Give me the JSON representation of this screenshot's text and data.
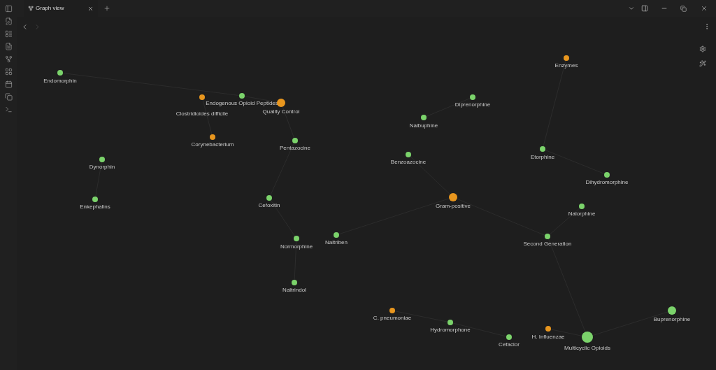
{
  "tabs": [
    {
      "label": "Graph view",
      "selected": true
    }
  ],
  "graph": {
    "nodes": [
      {
        "label": "Endomorphin",
        "color": "#7bd36b"
      },
      {
        "label": "Clostridioides difficile",
        "color": "#e8961e"
      },
      {
        "label": "Endogenous Opioid Peptides",
        "color": "#7bd36b"
      },
      {
        "label": "Quality Control",
        "color": "#e8961e"
      },
      {
        "label": "Enzymes",
        "color": "#e8961e"
      },
      {
        "label": "Diprenorphine",
        "color": "#7bd36b"
      },
      {
        "label": "Nalbuphine",
        "color": "#7bd36b"
      },
      {
        "label": "Corynebacterium",
        "color": "#e8961e"
      },
      {
        "label": "Pentazocine",
        "color": "#7bd36b"
      },
      {
        "label": "Benzoazocine",
        "color": "#7bd36b"
      },
      {
        "label": "Etorphine",
        "color": "#7bd36b"
      },
      {
        "label": "Dynorphin",
        "color": "#7bd36b"
      },
      {
        "label": "Dihydromorphine",
        "color": "#7bd36b"
      },
      {
        "label": "Enkephalins",
        "color": "#7bd36b"
      },
      {
        "label": "Cefoxitin",
        "color": "#7bd36b"
      },
      {
        "label": "Gram-positive",
        "color": "#e8961e"
      },
      {
        "label": "Nalorphine",
        "color": "#7bd36b"
      },
      {
        "label": "Normorphine",
        "color": "#7bd36b"
      },
      {
        "label": "Naltriben",
        "color": "#7bd36b"
      },
      {
        "label": "Second Generation",
        "color": "#7bd36b"
      },
      {
        "label": "Naltrindol",
        "color": "#7bd36b"
      },
      {
        "label": "C. pneumoniae",
        "color": "#e8961e"
      },
      {
        "label": "Buprenorphine",
        "color": "#7bd36b"
      },
      {
        "label": "Hydromorphone",
        "color": "#7bd36b"
      },
      {
        "label": "H. Influenzae",
        "color": "#e8961e"
      },
      {
        "label": "Cefaclor",
        "color": "#7bd36b"
      },
      {
        "label": "Multicyclic Opioids",
        "color": "#7bd36b"
      }
    ]
  }
}
